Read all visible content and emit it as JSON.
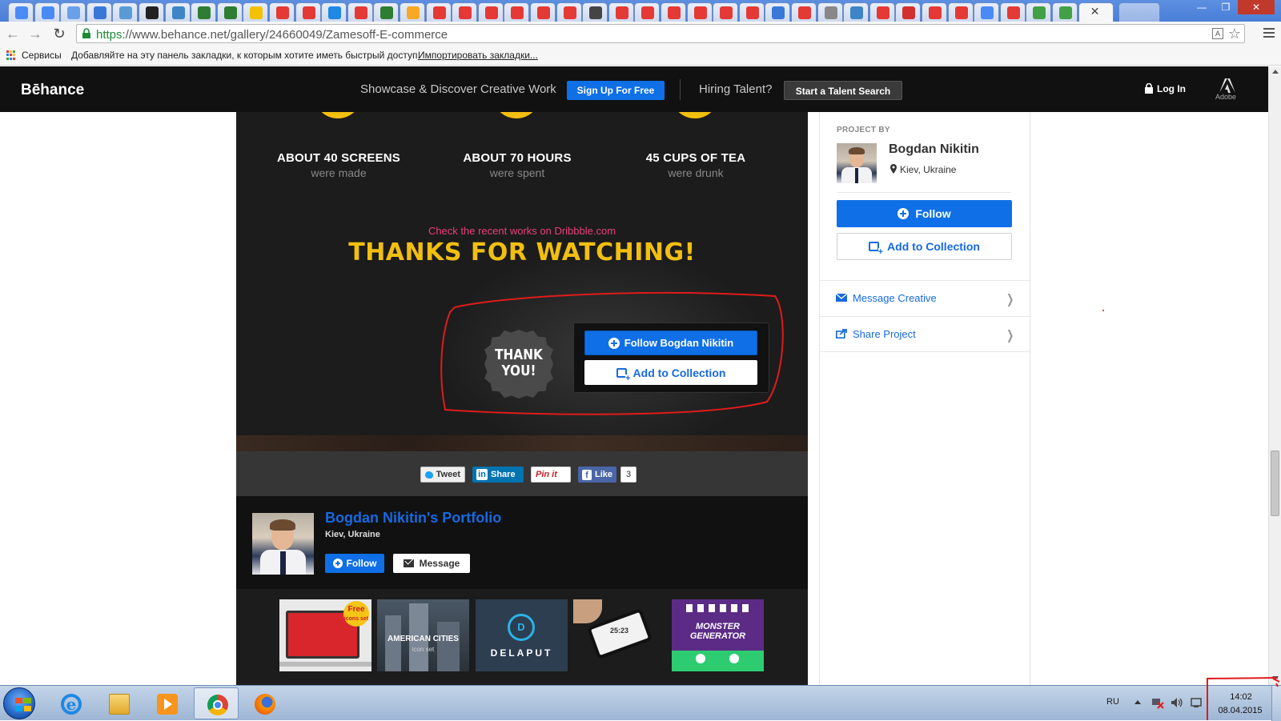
{
  "browser": {
    "url_https": "https",
    "url_rest": "://www.behance.net/gallery/24660049/Zamesoff-E-commerce",
    "bookmarks": {
      "services": "Сервисы",
      "hint": "Добавляйте на эту панель закладки, к которым хотите иметь быстрый доступ.",
      "import": "Импортировать закладки..."
    }
  },
  "header": {
    "logo": "Bēhance",
    "tagline": "Showcase & Discover Creative Work",
    "signup": "Sign Up For Free",
    "hiring": "Hiring Talent?",
    "talent_search": "Start a Talent Search",
    "login": "Log In",
    "adobe": "Adobe"
  },
  "project": {
    "stats": [
      {
        "title": "ABOUT 40 SCREENS",
        "sub": "were made"
      },
      {
        "title": "ABOUT 70 HOURS",
        "sub": "were spent"
      },
      {
        "title": "45 CUPS OF TEA",
        "sub": "were drunk"
      }
    ],
    "dribbble": "Check the recent works on Dribbble.com",
    "thanks": "THANKS FOR WATCHING!",
    "badge_line1": "THANK",
    "badge_line2": "YOU!",
    "follow_btn": "Follow Bogdan Nikitin",
    "collection_btn": "Add to Collection"
  },
  "share": {
    "tweet": "Tweet",
    "linkedin": "Share",
    "pinit": "Pin it",
    "like": "Like",
    "like_count": "3"
  },
  "portfolio": {
    "title": "Bogdan Nikitin's Portfolio",
    "location": "Kiev, Ukraine",
    "follow": "Follow",
    "message": "Message",
    "thumbs": [
      {
        "label": "Free icons set"
      },
      {
        "label": "AMERICAN CITIES",
        "sub": "icon set"
      },
      {
        "label": "DELAPUT"
      },
      {
        "label": "25:23"
      },
      {
        "label": "MONSTER GENERATOR"
      }
    ]
  },
  "sidebar": {
    "project_by": "PROJECT BY",
    "name": "Bogdan Nikitin",
    "location": "Kiev, Ukraine",
    "follow": "Follow",
    "collection": "Add to Collection",
    "message": "Message Creative",
    "share": "Share Project"
  },
  "taskbar": {
    "lang": "RU",
    "time": "14:02",
    "date": "08.04.2015"
  },
  "colors": {
    "behance_blue": "#0f6fe6",
    "thanks_yellow": "#f2bf10",
    "dribbble_pink": "#e8407a"
  }
}
